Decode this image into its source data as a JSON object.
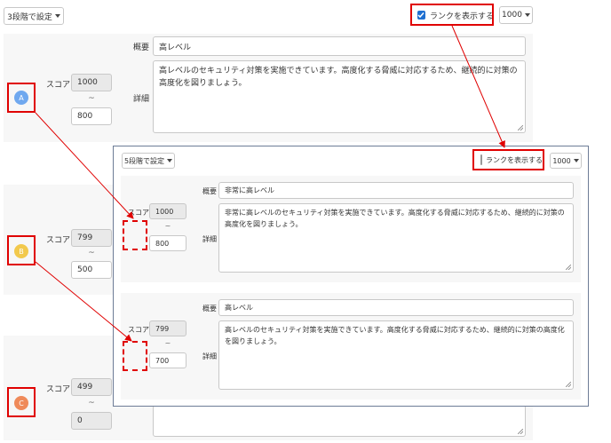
{
  "back": {
    "level_select_label": "3段階で設定",
    "show_rank_label": "ランクを表示する",
    "show_rank_checked": true,
    "max_select_label": "1000",
    "rows": [
      {
        "badge": "A",
        "badge_color": "#6fa8ef",
        "score_label": "スコア",
        "score_max": "1000",
        "tilde": "~",
        "score_min": "800",
        "summary_label": "概要",
        "summary": "高レベル",
        "detail_label": "詳細",
        "detail": "高レベルのセキュリティ対策を実施できています。高度化する脅威に対応するため、継続的に対策の高度化を図りましょう。"
      },
      {
        "badge": "B",
        "badge_color": "#f2c94c",
        "score_label": "スコア",
        "score_max": "799",
        "tilde": "~",
        "score_min": "500"
      },
      {
        "badge": "C",
        "badge_color": "#ef8a5a",
        "score_label": "スコア",
        "score_max": "499",
        "tilde": "~",
        "score_min": "0"
      }
    ]
  },
  "front": {
    "level_select_label": "5段階で設定",
    "show_rank_label": "ランクを表示する",
    "show_rank_checked": false,
    "max_select_label": "1000",
    "rows": [
      {
        "score_label": "スコア",
        "score_max": "1000",
        "tilde": "~",
        "score_min": "800",
        "summary_label": "概要",
        "summary": "非常に高レベル",
        "detail_label": "詳細",
        "detail": "非常に高レベルのセキュリティ対策を実施できています。高度化する脅威に対応するため、継続的に対策の高度化を図りましょう。"
      },
      {
        "score_label": "スコア",
        "score_max": "799",
        "tilde": "~",
        "score_min": "700",
        "summary_label": "概要",
        "summary": "高レベル",
        "detail_label": "詳細",
        "detail": "高レベルのセキュリティ対策を実施できています。高度化する脅威に対応するため、継続的に対策の高度化を図りましょう。"
      }
    ]
  },
  "colors": {
    "annotation_red": "#e00000",
    "checkbox_blue": "#1f6fd0"
  }
}
